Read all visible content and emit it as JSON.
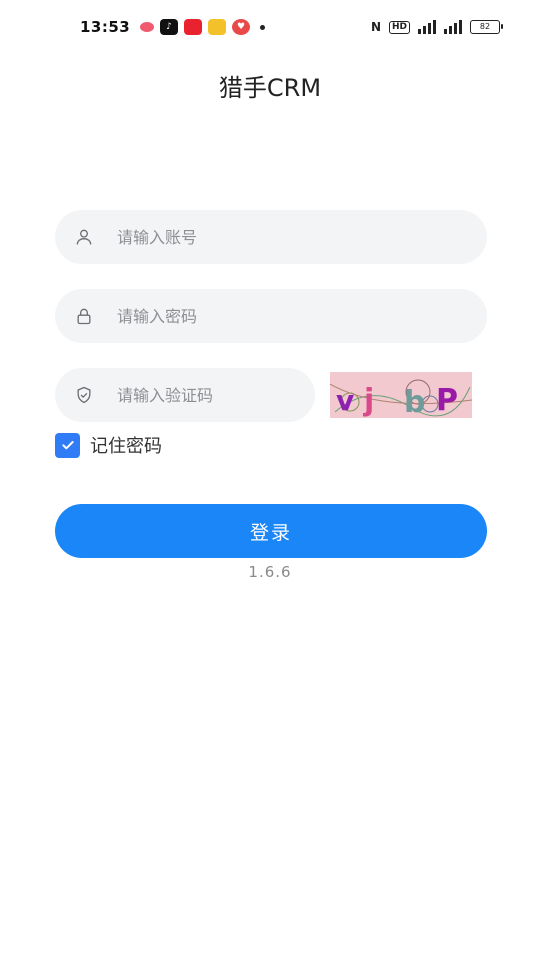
{
  "status_bar": {
    "time": "13:53",
    "battery": "82",
    "nfc": "N",
    "hd": "HD"
  },
  "title": "猎手CRM",
  "form": {
    "account_placeholder": "请输入账号",
    "password_placeholder": "请输入密码",
    "captcha_placeholder": "请输入验证码",
    "captcha_text": "vjbP",
    "remember_label": "记住密码",
    "remember_checked": true
  },
  "login_label": "登录",
  "version": "1.6.6",
  "colors": {
    "primary": "#1a86f7",
    "checkbox": "#2f7cf6",
    "input_bg": "#f3f4f6",
    "captcha_bg": "#f2c9cf"
  }
}
